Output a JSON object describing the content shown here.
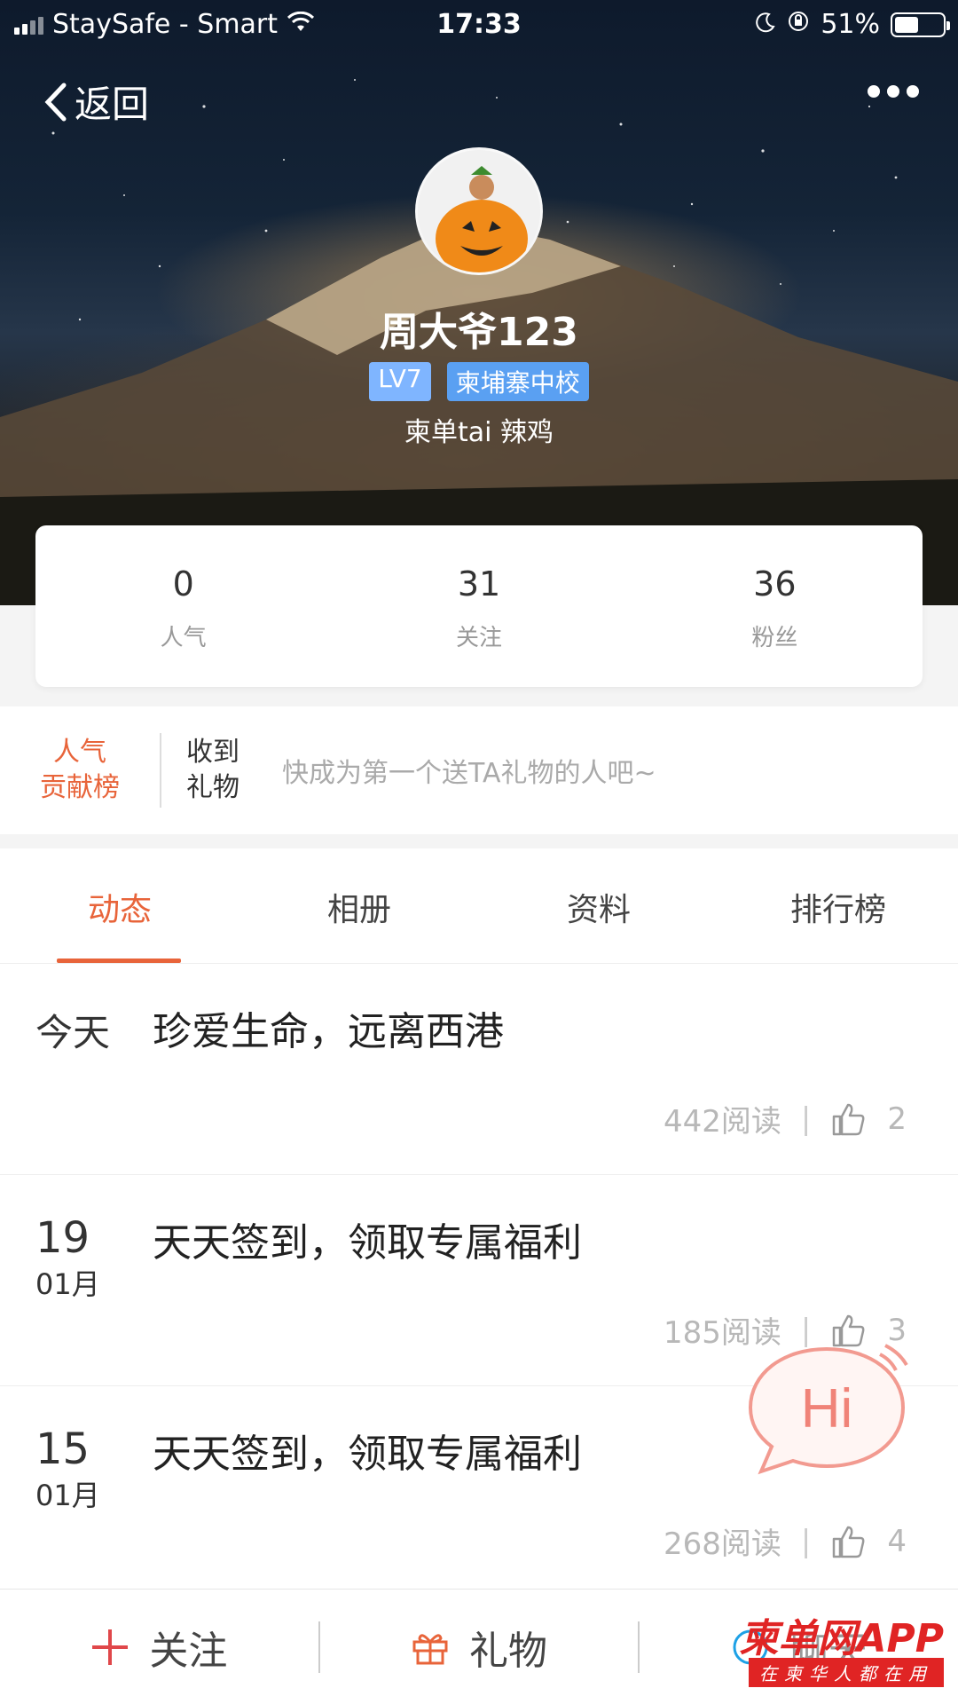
{
  "status_bar": {
    "carrier": "StaySafe - Smart",
    "time": "17:33",
    "battery": "51%"
  },
  "nav": {
    "back_label": "返回"
  },
  "profile": {
    "username": "周大爷123",
    "level": "LV7",
    "school": "柬埔寨中校",
    "signature": "柬单tai 辣鸡"
  },
  "stats": [
    {
      "value": "0",
      "label": "人气"
    },
    {
      "value": "31",
      "label": "关注"
    },
    {
      "value": "36",
      "label": "粉丝"
    }
  ],
  "gift_row": {
    "rank_line1": "人气",
    "rank_line2": "贡献榜",
    "received_line1": "收到",
    "received_line2": "礼物",
    "hint": "快成为第一个送TA礼物的人吧~"
  },
  "tabs": [
    {
      "label": "动态",
      "active": true
    },
    {
      "label": "相册"
    },
    {
      "label": "资料"
    },
    {
      "label": "排行榜"
    }
  ],
  "posts": [
    {
      "date_today": "今天",
      "title": "珍爱生命，远离西港",
      "reads": "442阅读",
      "likes": "2"
    },
    {
      "day": "19",
      "month": "01月",
      "title": "天天签到，领取专属福利",
      "reads": "185阅读",
      "likes": "3"
    },
    {
      "day": "15",
      "month": "01月",
      "title": "天天签到，领取专属福利",
      "reads": "268阅读",
      "likes": "4"
    }
  ],
  "hi_bubble": {
    "label": "Hi"
  },
  "bottom_bar": {
    "follow": "关注",
    "gift": "礼物",
    "chat": "聊天"
  },
  "watermark": {
    "main": "柬单网APP",
    "sub": "在柬华人都在用"
  },
  "colors": {
    "accent": "#e8643a",
    "badge": "#7fb5ff",
    "watermark": "#e02424"
  }
}
